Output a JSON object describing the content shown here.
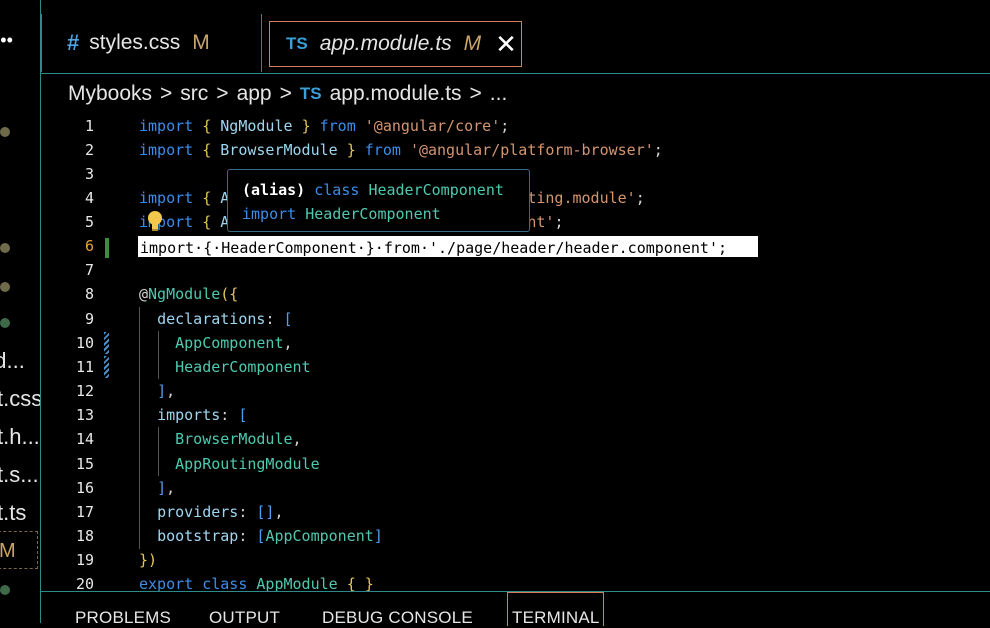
{
  "explorer": {
    "more_glyph": "•••",
    "files": [
      "od...",
      "t.css",
      "t.h...",
      "t.s...",
      "t.ts"
    ],
    "selected_badge": "M"
  },
  "tabs": [
    {
      "icon": "#",
      "label": "styles.css",
      "badge": "M"
    },
    {
      "icon": "TS",
      "label": "app.module.ts",
      "badge": "M",
      "close": "✕"
    }
  ],
  "breadcrumb": {
    "items": [
      "Mybooks",
      "src",
      "app"
    ],
    "file_icon": "TS",
    "file": "app.module.ts",
    "sep": ">",
    "ellipsis": "..."
  },
  "editor": {
    "line_numbers": [
      "1",
      "2",
      "3",
      "4",
      "5",
      "6",
      "7",
      "8",
      "9",
      "10",
      "11",
      "12",
      "13",
      "14",
      "15",
      "16",
      "17",
      "18",
      "19",
      "20"
    ],
    "active_line": "6",
    "highlighted_line": "import·{·HeaderComponent·}·from·'./page/header/header.component';"
  },
  "tooltip": {
    "line1_paren": "(alias)",
    "line1_kw": "class",
    "line1_name": "HeaderComponent",
    "line2_kw": "import",
    "line2_name": "HeaderComponent"
  },
  "panel": {
    "tabs": [
      "PROBLEMS",
      "OUTPUT",
      "DEBUG CONSOLE",
      "TERMINAL"
    ]
  },
  "colors": {
    "accent_border": "#d97b58",
    "separator": "#2d8a8a",
    "keyword": "#3a8de8",
    "string": "#d49570",
    "class": "#4ec9b0"
  }
}
